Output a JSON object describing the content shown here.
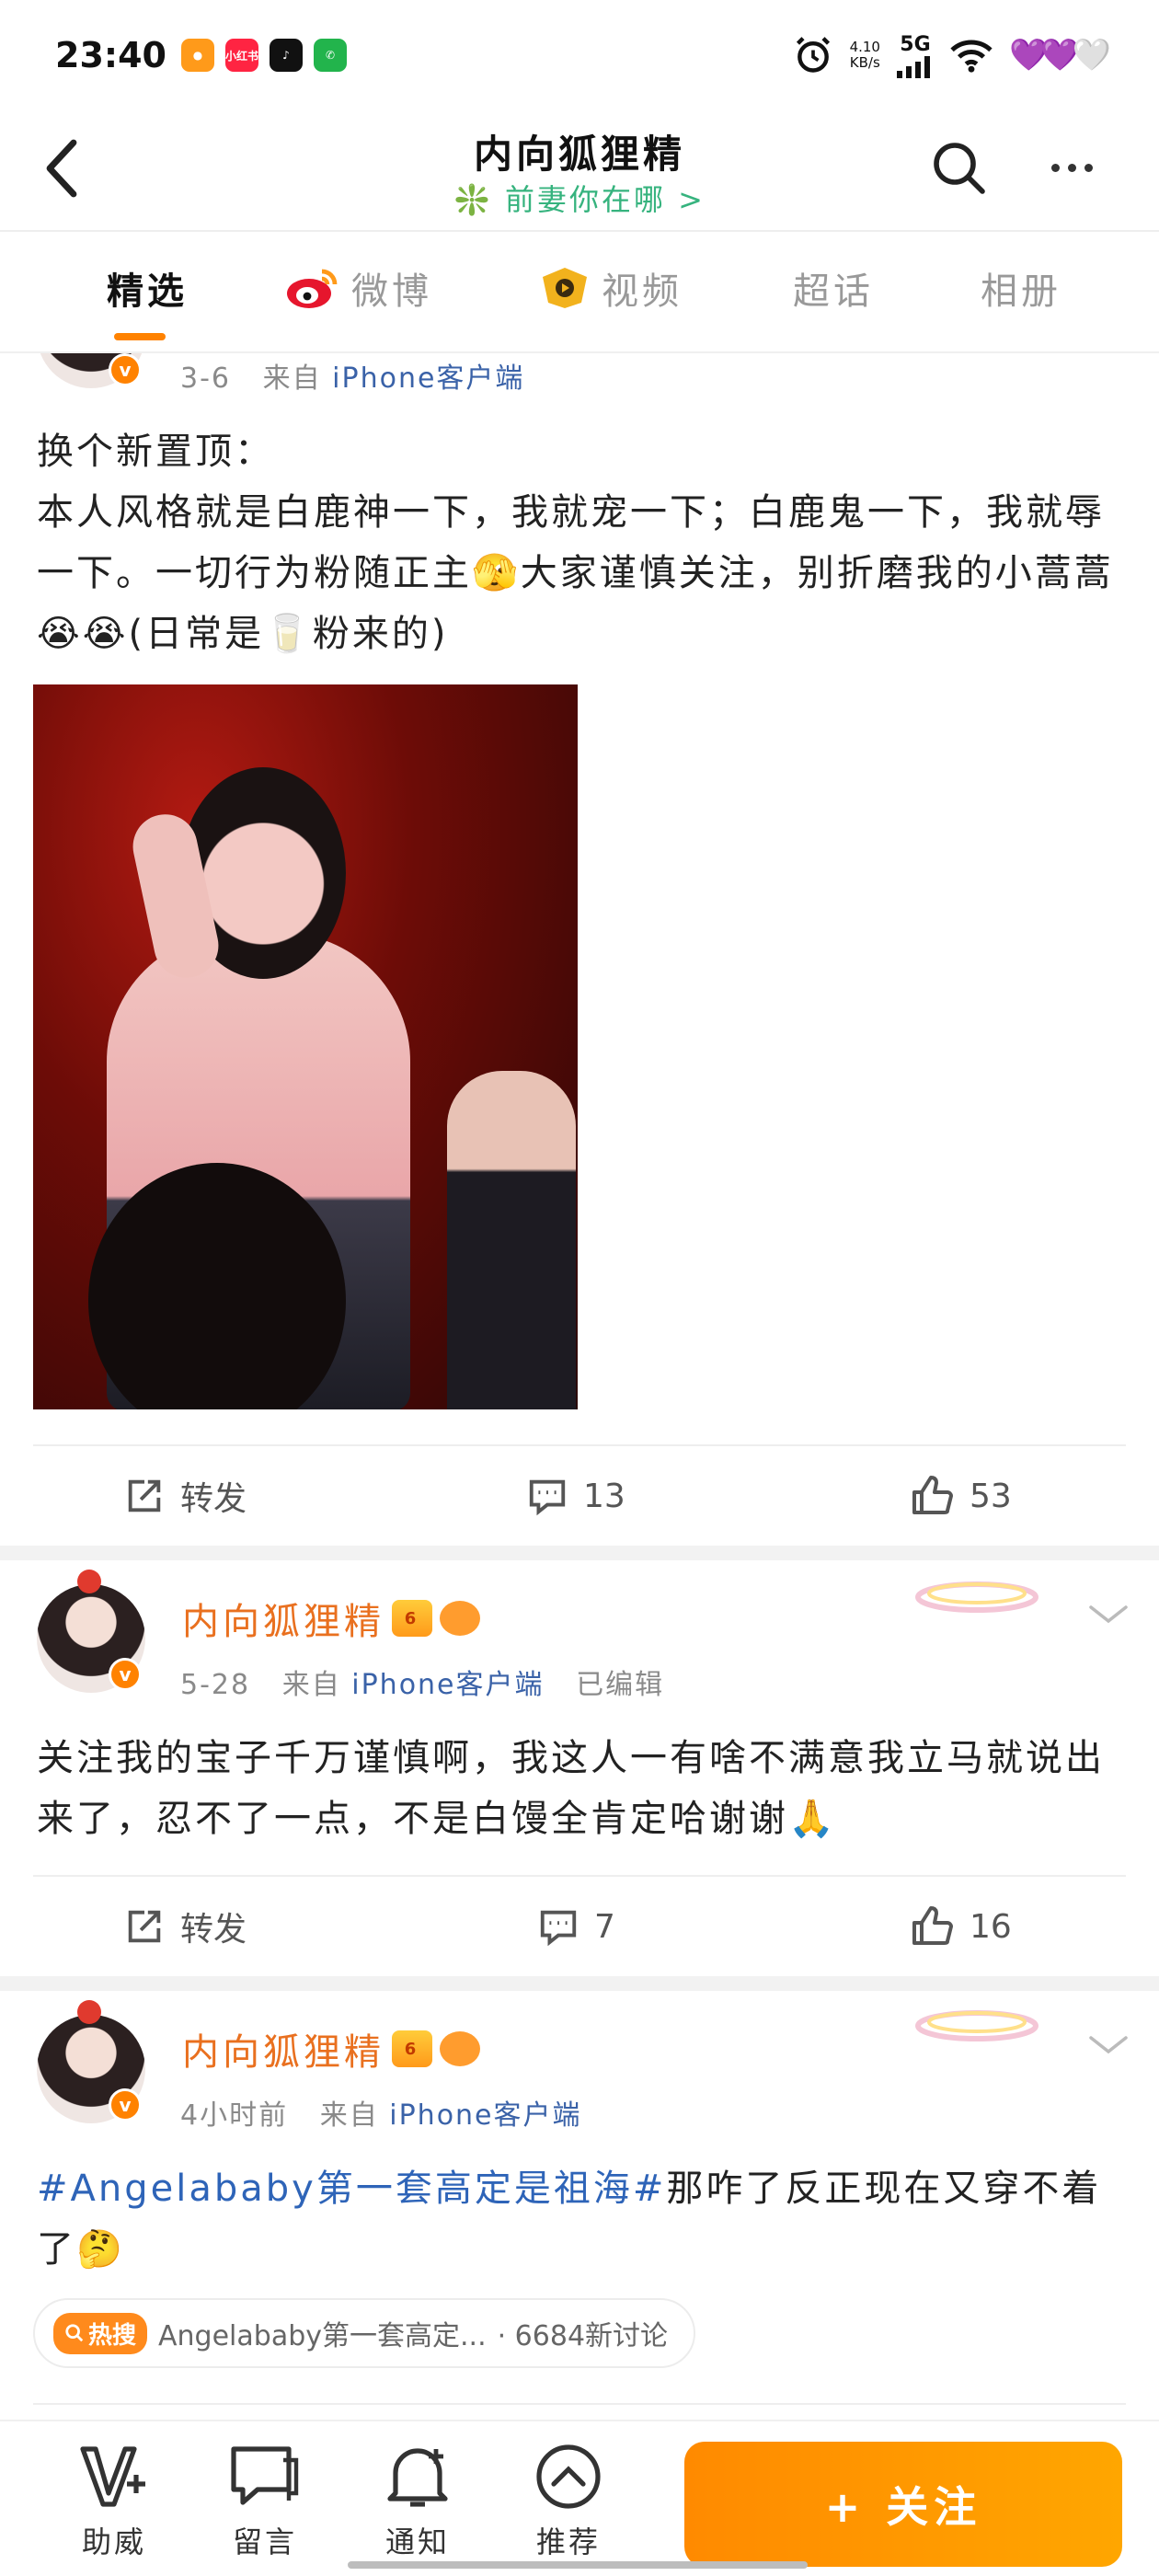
{
  "status_bar": {
    "time": "23:40",
    "apps": [
      {
        "name": "weibo-app-icon",
        "color": "#ff9a1a",
        "label": ""
      },
      {
        "name": "xiaohongshu-app-icon",
        "color": "#ff2442",
        "label": "小红书"
      },
      {
        "name": "tiktok-app-icon",
        "color": "#111111",
        "label": ""
      },
      {
        "name": "chat-app-icon",
        "color": "#22b44c",
        "label": ""
      }
    ],
    "net_speed_value": "4.10",
    "net_speed_unit": "KB/s",
    "signal": "5G",
    "hearts": "💜💜🤍"
  },
  "header": {
    "title": "内向狐狸精",
    "subtitle": "❇️ 前妻你在哪 >"
  },
  "tabs": [
    {
      "label": "精选",
      "active": true
    },
    {
      "label": "微博",
      "active": false
    },
    {
      "label": "视频",
      "active": false
    },
    {
      "label": "超话",
      "active": false
    },
    {
      "label": "相册",
      "active": false
    }
  ],
  "posts": [
    {
      "meta_date": "3-6",
      "meta_from": "来自",
      "meta_source": "iPhone客户端",
      "text_line1": "换个新置顶：",
      "text_line2": "本人风格就是白鹿神一下，我就宠一下；白鹿鬼一下，我就辱一下。一切行为粉随正主🫣大家谨慎关注，别折磨我的小蒿蒿😭😭(日常是🥛粉来的)",
      "actions": {
        "repost": "转发",
        "comments": "13",
        "likes": "53"
      }
    },
    {
      "username": "内向狐狸精",
      "crown_level": "6",
      "meta_date": "5-28",
      "meta_from": "来自",
      "meta_source": "iPhone客户端",
      "meta_edited": "已编辑",
      "text": "关注我的宝子千万谨慎啊，我这人一有啥不满意我立马就说出来了，忍不了一点，不是白馒全肯定哈谢谢🙏",
      "actions": {
        "repost": "转发",
        "comments": "7",
        "likes": "16"
      }
    },
    {
      "username": "内向狐狸精",
      "crown_level": "6",
      "meta_date": "4小时前",
      "meta_from": "来自",
      "meta_source": "iPhone客户端",
      "hashtag": "#Angelababy第一套高定是祖海#",
      "text_after": "那咋了反正现在又穿不着了🤔",
      "hot_tag": "热搜",
      "hot_topic": "Angelababy第一套高定...",
      "hot_count": "· 6684新讨论"
    }
  ],
  "bottom_bar": {
    "items": [
      {
        "label": "助威"
      },
      {
        "label": "留言"
      },
      {
        "label": "通知"
      },
      {
        "label": "推荐"
      }
    ],
    "follow_label": "+ 关注"
  },
  "colors": {
    "brand_orange": "#ff8200",
    "username_orange": "#e9701f",
    "link_blue": "#2e64b8",
    "subtitle_green": "#36b37e"
  }
}
